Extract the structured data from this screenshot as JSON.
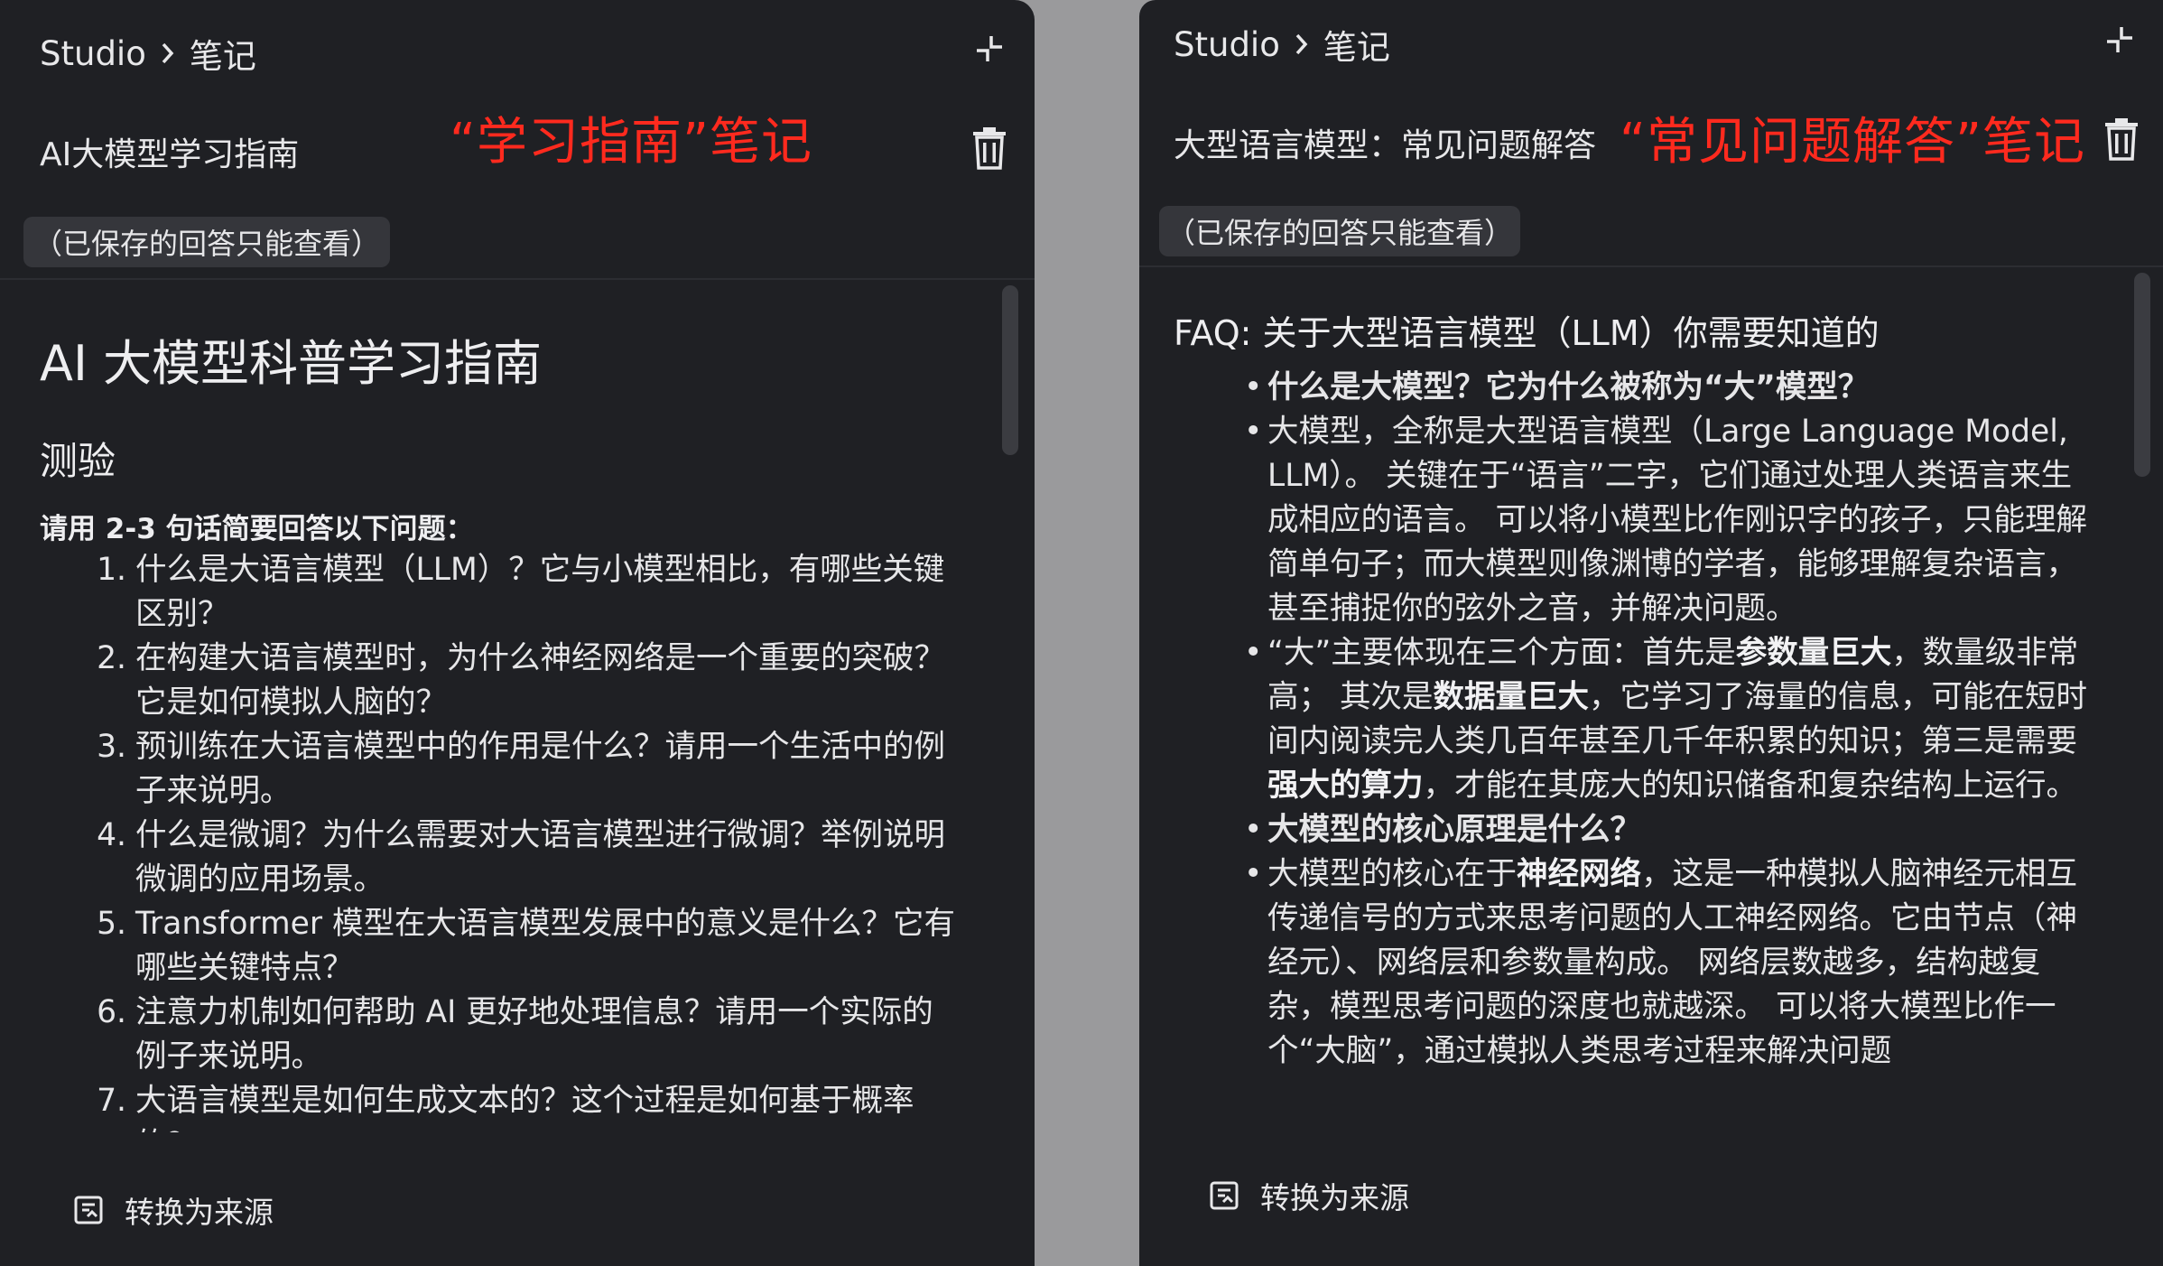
{
  "left_panel": {
    "breadcrumb": {
      "root": "Studio",
      "current": "笔记"
    },
    "note_title": "AI大模型学习指南",
    "annotation": "“学习指南”笔记",
    "saved_badge": "（已保存的回答只能查看）",
    "doc": {
      "h1": "AI 大模型科普学习指南",
      "h2": "测验",
      "instruction": "请用 2-3 句话简要回答以下问题：",
      "questions": [
        {
          "num": "1.",
          "text": "什么是大语言模型（LLM）？它与小模型相比，有哪些关键区别？"
        },
        {
          "num": "2.",
          "text": "在构建大语言模型时，为什么神经网络是一个重要的突破？它是如何模拟人脑的？"
        },
        {
          "num": "3.",
          "text": "预训练在大语言模型中的作用是什么？请用一个生活中的例子来说明。"
        },
        {
          "num": "4.",
          "text": "什么是微调？为什么需要对大语言模型进行微调？举例说明微调的应用场景。"
        },
        {
          "num": "5.",
          "text": "Transformer 模型在大语言模型发展中的意义是什么？它有哪些关键特点？"
        },
        {
          "num": "6.",
          "text": "注意力机制如何帮助 AI 更好地处理信息？请用一个实际的例子来说明。"
        },
        {
          "num": "7.",
          "text": "大语言模型是如何生成文本的？这个过程是如何基于概率的？"
        }
      ]
    },
    "convert_label": "转换为来源"
  },
  "right_panel": {
    "breadcrumb": {
      "root": "Studio",
      "current": "笔记"
    },
    "note_title": "大型语言模型：常见问题解答",
    "annotation": "“常见问题解答”笔记",
    "saved_badge": "（已保存的回答只能查看）",
    "faq": {
      "title": "FAQ: 关于大型语言模型（LLM）你需要知道的",
      "q1": "什么是大模型？它为什么被称为“大”模型？",
      "a1": "大模型，全称是大型语言模型（Large Language Model, LLM）。 关键在于“语言”二字，它们通过处理人类语言来生成相应的语言。 可以将小模型比作刚识字的孩子，只能理解简单句子；而大模型则像渊博的学者，能够理解复杂语言，甚至捕捉你的弦外之音，并解决问题。",
      "a2": {
        "t1": "“大”主要体现在三个方面：首先是",
        "b1": "参数量巨大",
        "t2": "，数量级非常高； 其次是",
        "b2": "数据量巨大",
        "t3": "，它学习了海量的信息，可能在短时间内阅读完人类几百年甚至几千年积累的知识；第三是需要",
        "b3": "强大的算力",
        "t4": "，才能在其庞大的知识储备和复杂结构上运行。"
      },
      "q2": "大模型的核心原理是什么？",
      "a3": {
        "t1": "大模型的核心在于",
        "b1": "神经网络",
        "t2": "，这是一种模拟人脑神经元相互传递信号的方式来思考问题的人工神经网络。它由节点（神经元）、网络层和参数量构成。 网络层数越多，结构越复杂，模型思考问题的深度也就越深。 可以将大模型比作一个“大脑”，通过模拟人类思考过程来解决问题"
      }
    },
    "convert_label": "转换为来源"
  }
}
